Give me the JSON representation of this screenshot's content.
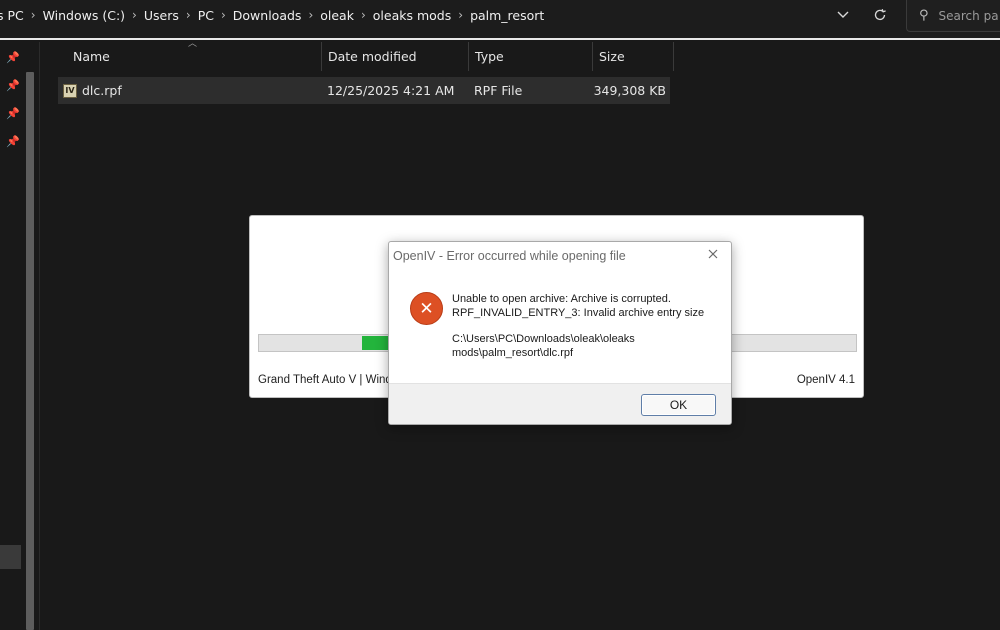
{
  "explorer": {
    "breadcrumb": [
      "s PC",
      "Windows (C:)",
      "Users",
      "PC",
      "Downloads",
      "oleak",
      "oleaks mods",
      "palm_resort"
    ],
    "search_placeholder": "Search pa",
    "columns": {
      "name": "Name",
      "date": "Date modified",
      "type": "Type",
      "size": "Size"
    },
    "files": [
      {
        "icon": "IV",
        "name": "dlc.rpf",
        "date": "12/25/2025 4:21 AM",
        "type": "RPF File",
        "size": "349,308 KB"
      }
    ]
  },
  "loader": {
    "progress": 0.1,
    "footer_left": "Grand Theft Auto V | Windo",
    "footer_right": "OpenIV 4.1"
  },
  "dialog": {
    "title": "OpenIV - Error occurred while opening file",
    "message_lines": [
      "Unable to open archive: Archive is corrupted.",
      "RPF_INVALID_ENTRY_3: Invalid archive entry size"
    ],
    "path_lines": [
      "C:\\Users\\PC\\Downloads\\oleak\\oleaks",
      "mods\\palm_resort\\dlc.rpf"
    ],
    "ok_label": "OK"
  },
  "colors": {
    "error_icon": "#dd5024",
    "progress": "#23b43c",
    "explorer_bg": "#191919"
  }
}
